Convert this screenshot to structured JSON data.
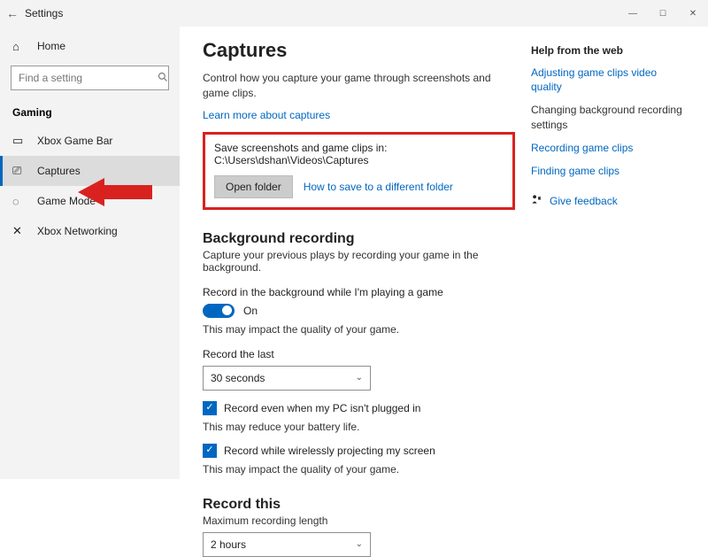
{
  "window": {
    "title": "Settings"
  },
  "sidebar": {
    "home_label": "Home",
    "search_placeholder": "Find a setting",
    "category": "Gaming",
    "items": [
      {
        "label": "Xbox Game Bar"
      },
      {
        "label": "Captures"
      },
      {
        "label": "Game Mode"
      },
      {
        "label": "Xbox Networking"
      }
    ],
    "active_index": 1
  },
  "main": {
    "title": "Captures",
    "description": "Control how you capture your game through screenshots and game clips.",
    "learn_more": "Learn more about captures",
    "save_location": {
      "prefix": "Save screenshots and game clips in: ",
      "path": "C:\\Users\\dshan\\Videos\\Captures",
      "open_button": "Open folder",
      "how_link": "How to save to a different folder"
    },
    "background": {
      "title": "Background recording",
      "subtitle": "Capture your previous plays by recording your game in the background.",
      "toggle_label": "Record in the background while I'm playing a game",
      "toggle_state": "On",
      "toggle_hint": "This may impact the quality of your game.",
      "record_last_label": "Record the last",
      "record_last_value": "30 seconds",
      "check1": "Record even when my PC isn't plugged in",
      "check1_hint": "This may reduce your battery life.",
      "check2": "Record while wirelessly projecting my screen",
      "check2_hint": "This may impact the quality of your game."
    },
    "record_this": {
      "title": "Record this",
      "max_label": "Maximum recording length",
      "max_value": "2 hours"
    }
  },
  "help": {
    "title": "Help from the web",
    "links": {
      "l1": "Adjusting game clips video quality",
      "l2": "Changing background recording settings",
      "l3": "Recording game clips",
      "l4": "Finding game clips"
    },
    "feedback": "Give feedback"
  }
}
